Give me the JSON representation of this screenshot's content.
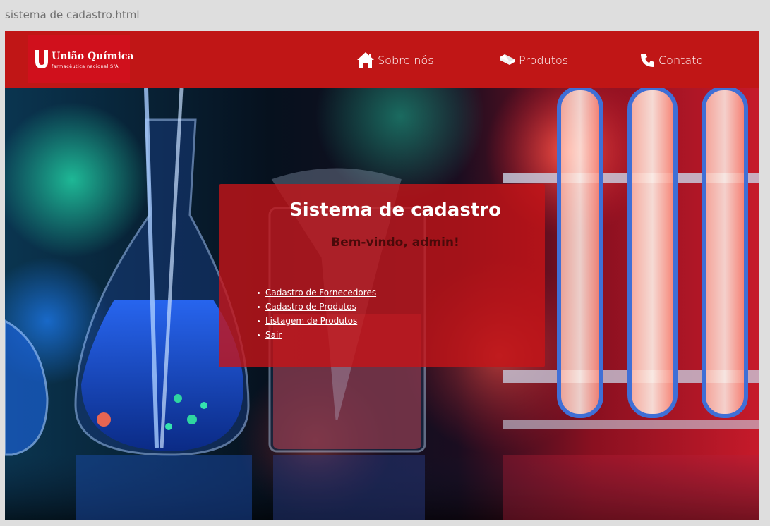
{
  "file_tab": {
    "title": "sistema de cadastro.html"
  },
  "header": {
    "logo": {
      "name": "União Química",
      "tagline": "farmacêutica nacional S/A"
    },
    "nav": [
      {
        "label": "Sobre nós",
        "icon": "home-icon"
      },
      {
        "label": "Produtos",
        "icon": "pill-icon"
      },
      {
        "label": "Contato",
        "icon": "phone-icon"
      }
    ]
  },
  "card": {
    "title": "Sistema de cadastro",
    "welcome": "Bem-vindo, admin!",
    "links": [
      "Cadastro de Fornecedores",
      "Cadastro de Produtos",
      "Listagem de Produtos",
      "Sair"
    ]
  },
  "colors": {
    "header_bg": "#c01616",
    "card_bg": "rgba(198,20,24,0.80)",
    "welcome_text": "#4a0a0a"
  }
}
